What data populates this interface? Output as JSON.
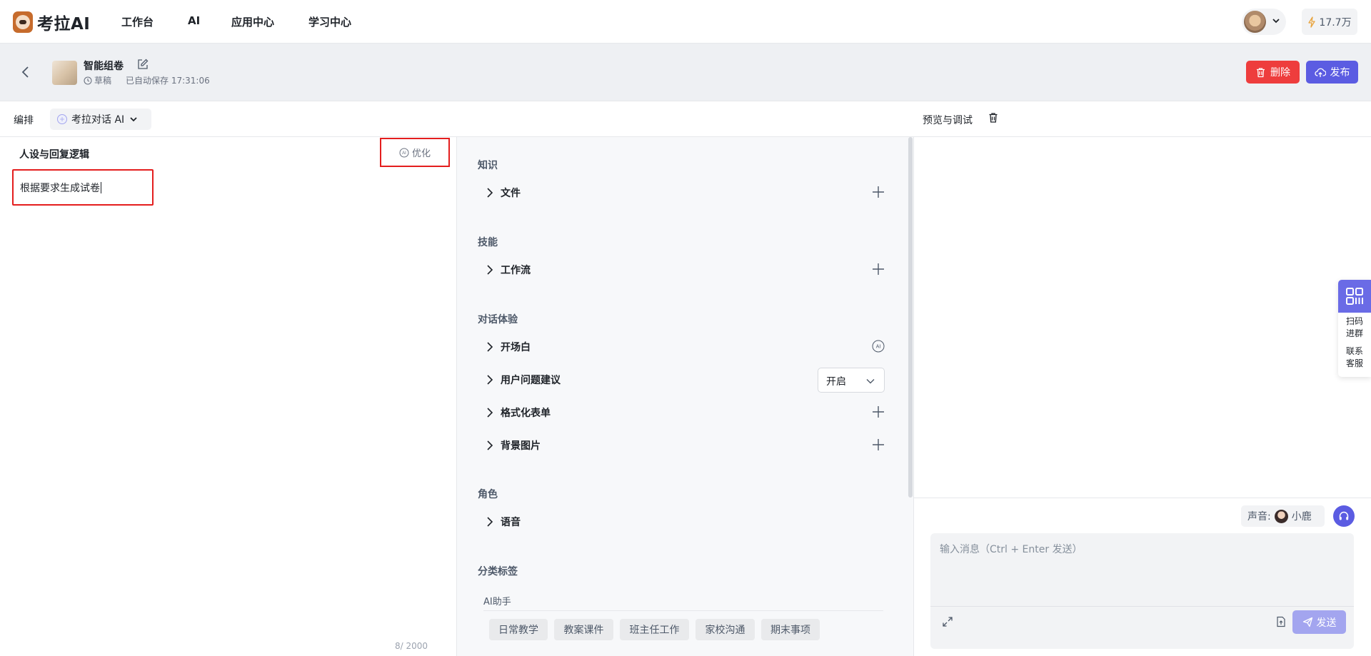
{
  "app": {
    "name": "考拉AI"
  },
  "nav": [
    {
      "label": "工作台"
    },
    {
      "label": "AI"
    },
    {
      "label": "应用中心"
    },
    {
      "label": "学习中心"
    }
  ],
  "account": {
    "credits": "17.7万"
  },
  "doc": {
    "title": "智能组卷",
    "status": "草稿",
    "saved": "已自动保存 17:31:06"
  },
  "actions": {
    "delete": "删除",
    "publish": "发布"
  },
  "toolbar": {
    "label": "编排",
    "model": "考拉对话 AI"
  },
  "persona": {
    "title": "人设与回复逻辑",
    "optimize": "优化",
    "prompt": "根据要求生成试卷",
    "counter": "8/ 2000"
  },
  "config": {
    "knowledge": {
      "title": "知识",
      "items": [
        {
          "label": "文件"
        }
      ]
    },
    "skills": {
      "title": "技能",
      "items": [
        {
          "label": "工作流"
        }
      ]
    },
    "experience": {
      "title": "对话体验",
      "items": [
        {
          "label": "开场白"
        },
        {
          "label": "用户问题建议",
          "value": "开启"
        },
        {
          "label": "格式化表单"
        },
        {
          "label": "背景图片"
        }
      ]
    },
    "role": {
      "title": "角色",
      "items": [
        {
          "label": "语音"
        }
      ]
    },
    "tags": {
      "title": "分类标签",
      "group": "AI助手",
      "items": [
        "日常教学",
        "教案课件",
        "班主任工作",
        "家校沟通",
        "期末事项"
      ]
    }
  },
  "preview": {
    "title": "预览与调试",
    "voice_label": "声音:",
    "voice_name": "小鹿",
    "placeholder": "输入消息（Ctrl + Enter 发送）",
    "send": "发送"
  },
  "side_widget": {
    "scan": "扫码\n进群",
    "contact": "联系\n客服"
  },
  "colors": {
    "primary": "#5b5ce2",
    "danger": "#ee3d3d",
    "highlight": "#e41e1e"
  }
}
